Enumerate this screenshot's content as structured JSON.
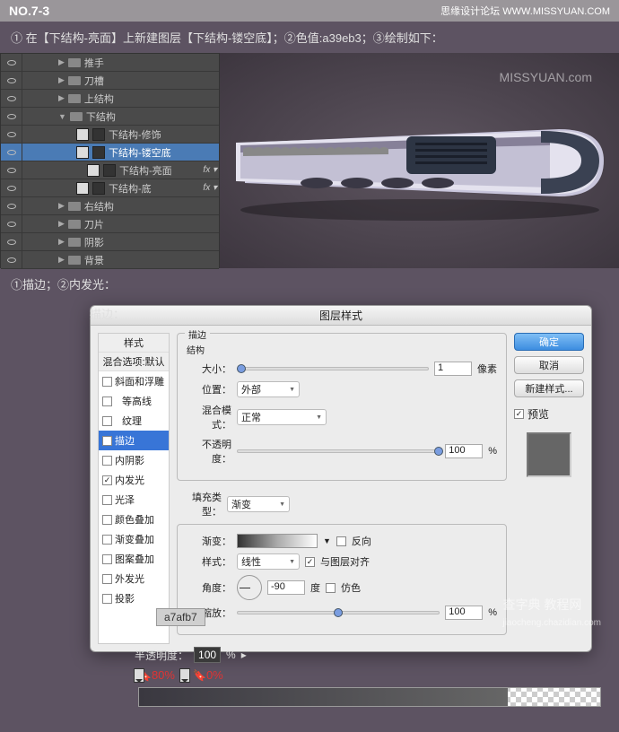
{
  "header": {
    "step": "NO.7-3",
    "site": "思缘设计论坛",
    "site_url": "WWW.MISSYUAN.COM"
  },
  "instruction1": "① 在【下结构-亮面】上新建图层【下结构-镂空底】；②色值:a39eb3；③绘制如下：",
  "instruction2": "①描边；②内发光：",
  "dialog_box_label": "描边：",
  "layers": [
    {
      "label": "推手",
      "type": "folder",
      "indent": 1,
      "open": false
    },
    {
      "label": "刀槽",
      "type": "folder",
      "indent": 1,
      "open": false
    },
    {
      "label": "上结构",
      "type": "folder",
      "indent": 1,
      "open": false
    },
    {
      "label": "下结构",
      "type": "folder",
      "indent": 1,
      "open": true
    },
    {
      "label": "下结构-修饰",
      "type": "layer",
      "indent": 2
    },
    {
      "label": "下结构-镂空底",
      "type": "layer",
      "indent": 2,
      "selected": true
    },
    {
      "label": "下结构-亮面",
      "type": "layer",
      "indent": 3,
      "fx": true
    },
    {
      "label": "下结构-底",
      "type": "layer",
      "indent": 2,
      "fx": true
    },
    {
      "label": "右结构",
      "type": "folder",
      "indent": 1,
      "open": false
    },
    {
      "label": "刀片",
      "type": "folder",
      "indent": 1,
      "open": false
    },
    {
      "label": "阴影",
      "type": "folder",
      "indent": 1,
      "open": false
    },
    {
      "label": "背景",
      "type": "folder",
      "indent": 1,
      "open": false
    }
  ],
  "dialog": {
    "title": "图层样式",
    "styles_header": "样式",
    "blend_header": "混合选项:默认",
    "styles": [
      {
        "label": "斜面和浮雕",
        "checked": false
      },
      {
        "label": "等高线",
        "checked": false,
        "sub": true
      },
      {
        "label": "纹理",
        "checked": false,
        "sub": true
      },
      {
        "label": "描边",
        "checked": true,
        "selected": true
      },
      {
        "label": "内阴影",
        "checked": false
      },
      {
        "label": "内发光",
        "checked": true
      },
      {
        "label": "光泽",
        "checked": false
      },
      {
        "label": "颜色叠加",
        "checked": false
      },
      {
        "label": "渐变叠加",
        "checked": false
      },
      {
        "label": "图案叠加",
        "checked": false
      },
      {
        "label": "外发光",
        "checked": false
      },
      {
        "label": "投影",
        "checked": false
      }
    ],
    "section_stroke": "描边",
    "section_struct": "结构",
    "size_label": "大小：",
    "size_value": "1",
    "size_unit": "像素",
    "position_label": "位置：",
    "position_value": "外部",
    "blend_label": "混合模式：",
    "blend_value": "正常",
    "opacity_label": "不透明度：",
    "opacity_value": "100",
    "opacity_unit": "%",
    "fill_type_label": "填充类型：",
    "fill_type_value": "渐变",
    "gradient_label": "渐变：",
    "style_label": "样式：",
    "style_value": "线性",
    "reverse_label": "反向",
    "align_label": "与图层对齐",
    "angle_label": "角度：",
    "angle_value": "-90",
    "angle_unit": "度",
    "dither_label": "仿色",
    "scale_label": "缩放：",
    "scale_value": "100",
    "scale_unit": "%",
    "btn_ok": "确定",
    "btn_cancel": "取消",
    "btn_new": "新建样式...",
    "preview_label": "预览"
  },
  "half_opacity_label": "半透明度：",
  "half_opacity_value": "100",
  "half_opacity_unit": "%",
  "stops": {
    "stop1": "80%",
    "stop2": "0%"
  },
  "hex_value": "a7afb7",
  "watermark_top": "MISSYUAN.com",
  "watermark_bot1": "查字典 教程网",
  "watermark_bot2": "jiaocheng.chazidian.com"
}
